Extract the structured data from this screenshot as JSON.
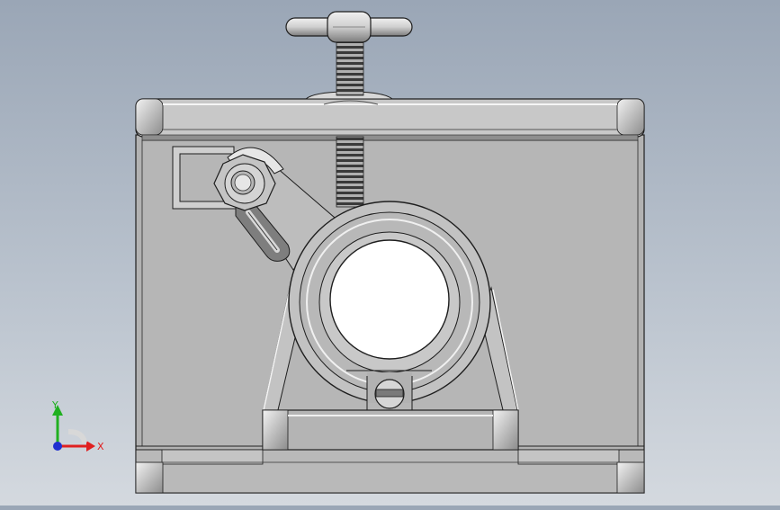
{
  "viewport": {
    "background_top": "#9aa6b6",
    "background_bottom": "#d4d9df",
    "part_face_color": "#b5b5b5",
    "edge_color": "#1e1e1e",
    "highlight_color": "#f2f2f2"
  },
  "triad": {
    "x_label": "X",
    "y_label": "Y",
    "x_color": "#e02020",
    "y_color": "#20b020",
    "z_color": "#2030d0"
  },
  "model": {
    "parts": [
      "housing-body",
      "top-cover-plate",
      "t-handle-screw",
      "pipe-clamp-saddle",
      "lever-link",
      "hex-nut",
      "slotted-screw",
      "base-support-block"
    ]
  }
}
